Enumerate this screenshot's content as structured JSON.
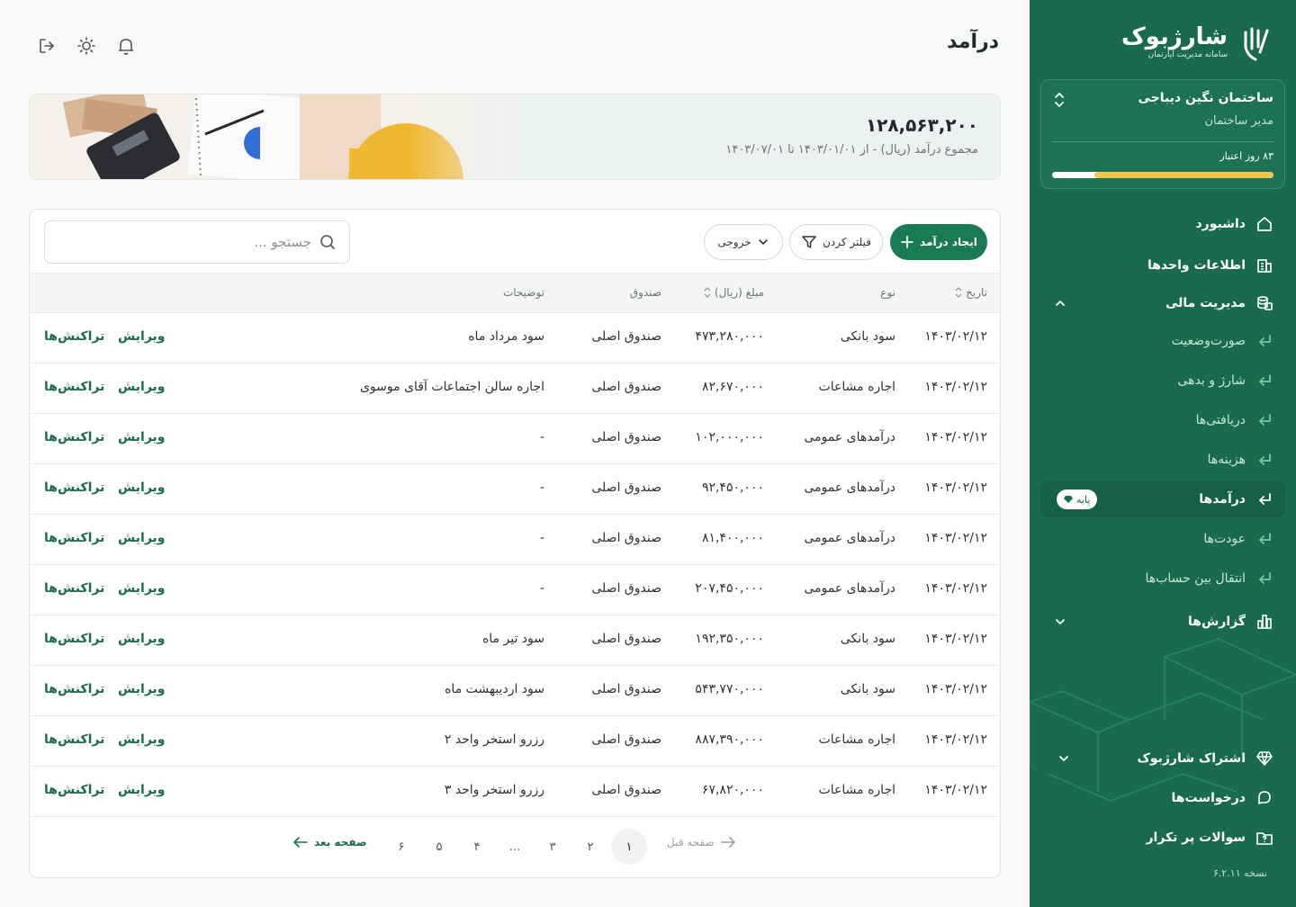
{
  "header": {
    "title": "درآمد",
    "icons": [
      "logout-icon",
      "sun-icon",
      "bell-icon"
    ]
  },
  "sidebar": {
    "logo_text": "شارژبوک",
    "logo_subtitle": "سامانه مدیریت آپارتمان",
    "building": {
      "name": "ساختمان نگین دیباجی",
      "role": "مدیر ساختمان",
      "credit_text": "۸۳ روز اعتبار",
      "credit_fraction": 0.81
    },
    "items": [
      {
        "label": "داشبورد",
        "icon": "home-icon"
      },
      {
        "label": "اطلاعات واحدها",
        "icon": "building-icon"
      },
      {
        "label": "مدیریت مالی",
        "icon": "coins-icon"
      },
      {
        "label": "صورت‌وضعیت",
        "icon": "return-arrow-icon"
      },
      {
        "label": "شارژ و بدهی",
        "icon": "return-arrow-icon"
      },
      {
        "label": "دریافتی‌ها",
        "icon": "return-arrow-icon"
      },
      {
        "label": "هزینه‌ها",
        "icon": "return-arrow-icon"
      },
      {
        "label": "درآمدها",
        "icon": "return-arrow-icon",
        "badge": "پایه"
      },
      {
        "label": "عودت‌ها",
        "icon": "return-arrow-icon"
      },
      {
        "label": "انتقال بین حساب‌ها",
        "icon": "return-arrow-icon"
      },
      {
        "label": "گزارش‌ها",
        "icon": "chart-icon"
      },
      {
        "label": "اشتراک شارژبوک",
        "icon": "diamond-icon"
      },
      {
        "label": "درخواست‌ها",
        "icon": "chat-icon"
      },
      {
        "label": "سوالات پر تکرار",
        "icon": "faq-folder-icon"
      }
    ],
    "version": "نسخه ۶.۲.۱۱"
  },
  "summary": {
    "amount": "۱۲۸,۵۶۳,۲۰۰",
    "range": "مجموع درآمد (ریال) - از ۱۴۰۳/۰۱/۰۱  تا  ۱۴۰۳/۰۷/۰۱"
  },
  "toolbar": {
    "create_label": "ایجاد درآمد",
    "filter_label": "فیلتر کردن",
    "export_label": "خروجی",
    "search_placeholder": "جستجو ..."
  },
  "table": {
    "columns": {
      "date": "تاریخ",
      "type": "نوع",
      "amount": "مبلغ (ریال)",
      "fund": "صندوق",
      "desc": "توضیحات"
    },
    "edit_label": "ویرایش",
    "tx_label": "تراکنش‌ها",
    "rows": [
      {
        "date": "۱۴۰۳/۰۲/۱۲",
        "type": "سود بانکی",
        "amount": "۴۷۳,۲۸۰,۰۰۰",
        "fund": "صندوق اصلی",
        "desc": "سود مرداد ماه"
      },
      {
        "date": "۱۴۰۳/۰۲/۱۲",
        "type": "اجاره مشاعات",
        "amount": "۸۲,۶۷۰,۰۰۰",
        "fund": "صندوق اصلی",
        "desc": "اجاره سالن اجتماعات آقای موسوی"
      },
      {
        "date": "۱۴۰۳/۰۲/۱۲",
        "type": "درآمدهای عمومی",
        "amount": "۱۰۲,۰۰۰,۰۰۰",
        "fund": "صندوق اصلی",
        "desc": "-"
      },
      {
        "date": "۱۴۰۳/۰۲/۱۲",
        "type": "درآمدهای عمومی",
        "amount": "۹۲,۴۵۰,۰۰۰",
        "fund": "صندوق اصلی",
        "desc": "-"
      },
      {
        "date": "۱۴۰۳/۰۲/۱۲",
        "type": "درآمدهای عمومی",
        "amount": "۸۱,۴۰۰,۰۰۰",
        "fund": "صندوق اصلی",
        "desc": "-"
      },
      {
        "date": "۱۴۰۳/۰۲/۱۲",
        "type": "درآمدهای عمومی",
        "amount": "۲۰۷,۴۵۰,۰۰۰",
        "fund": "صندوق اصلی",
        "desc": "-"
      },
      {
        "date": "۱۴۰۳/۰۲/۱۲",
        "type": "سود بانکی",
        "amount": "۱۹۲,۳۵۰,۰۰۰",
        "fund": "صندوق اصلی",
        "desc": "سود تیر ماه"
      },
      {
        "date": "۱۴۰۳/۰۲/۱۲",
        "type": "سود بانکی",
        "amount": "۵۴۳,۷۷۰,۰۰۰",
        "fund": "صندوق اصلی",
        "desc": "سود اردیبهشت ماه"
      },
      {
        "date": "۱۴۰۳/۰۲/۱۲",
        "type": "اجاره مشاعات",
        "amount": "۸۸۷,۳۹۰,۰۰۰",
        "fund": "صندوق اصلی",
        "desc": "رزرو استخر واحد ۲"
      },
      {
        "date": "۱۴۰۳/۰۲/۱۲",
        "type": "اجاره مشاعات",
        "amount": "۶۷,۸۲۰,۰۰۰",
        "fund": "صندوق اصلی",
        "desc": "رزرو استخر واحد ۳"
      }
    ]
  },
  "pagination": {
    "prev_label": "صفحه قبل",
    "next_label": "صفحه بعد",
    "pages": [
      "۱",
      "۲",
      "۳",
      "...",
      "۴",
      "۵",
      "۶"
    ],
    "current": "۱"
  },
  "colors": {
    "brand": "#1a6b4e",
    "accent": "#f3c64a",
    "primary_button": "#1a7a55"
  }
}
